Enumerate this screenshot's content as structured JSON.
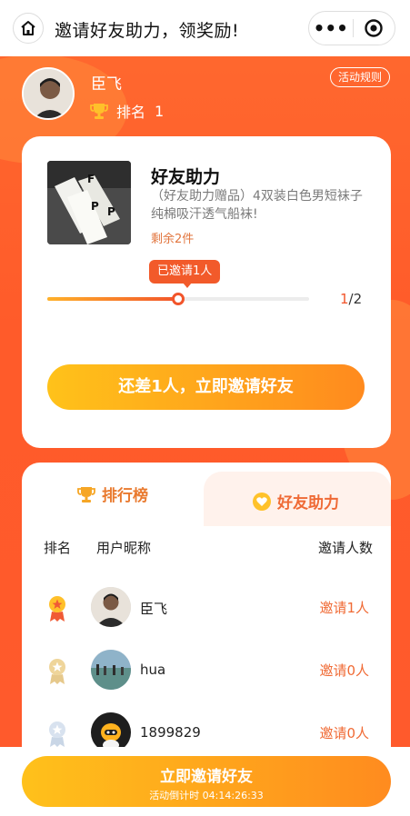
{
  "nav": {
    "title": "邀请好友助力，领奖励!",
    "more_label": "•••"
  },
  "user": {
    "name": "臣飞",
    "rank_label": "排名",
    "rank_value": "1",
    "rules_label": "活动规则"
  },
  "product": {
    "title": "好友助力",
    "description": "（好友助力赠品）4双装白色男短袜子纯棉吸汗透气船袜!",
    "stock": "剩余2件"
  },
  "progress": {
    "tip": "已邀请1人",
    "current": "1",
    "total": "/2",
    "fraction": 0.5
  },
  "cta_label": "还差1人，立即邀请好友",
  "ranking": {
    "tab_active": "排行榜",
    "tab_other": "好友助力",
    "headers": {
      "rank": "排名",
      "nickname": "用户昵称",
      "invites": "邀请人数"
    },
    "rows": [
      {
        "name": "臣飞",
        "invites": "邀请1人",
        "medal": "gold"
      },
      {
        "name": "hua",
        "invites": "邀请0人",
        "medal": "silver-gold"
      },
      {
        "name": "1899829",
        "invites": "邀请0人",
        "medal": "silver"
      }
    ]
  },
  "bottom": {
    "button_label": "立即邀请好友",
    "countdown": "活动倒计时 04:14:26:33"
  },
  "colors": {
    "accent": "#f2552b",
    "button_start": "#ffc21a",
    "button_end": "#ff8a1e"
  }
}
